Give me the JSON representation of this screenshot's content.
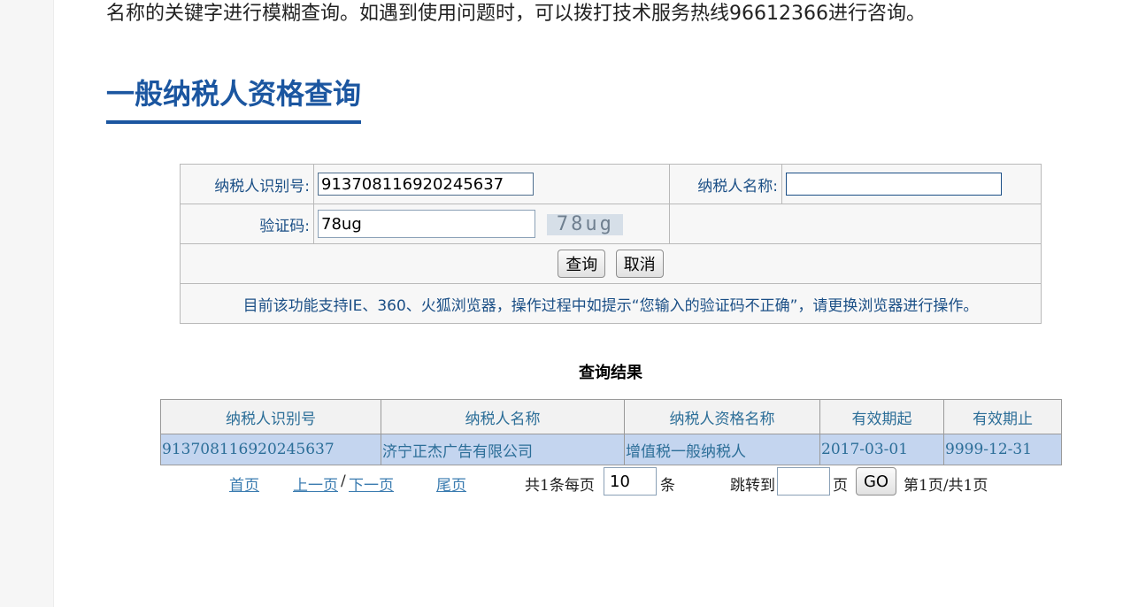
{
  "intro_text": "名称的关键字进行模糊查询。如遇到使用问题时，可以拨打技术服务热线96612366进行咨询。",
  "heading": "一般纳税人资格查询",
  "form": {
    "taxpayer_id_label": "纳税人识别号:",
    "taxpayer_id_value": "913708116920245637",
    "taxpayer_name_label": "纳税人名称:",
    "taxpayer_name_value": "",
    "captcha_label": "验证码:",
    "captcha_value": "78ug",
    "captcha_image_text": "78ug",
    "query_button": "查询",
    "cancel_button": "取消",
    "notice": "目前该功能支持IE、360、火狐浏览器，操作过程中如提示“您输入的验证码不正确”，请更换浏览器进行操作。"
  },
  "results": {
    "title": "查询结果",
    "columns": [
      "纳税人识别号",
      "纳税人名称",
      "纳税人资格名称",
      "有效期起",
      "有效期止"
    ],
    "rows": [
      [
        "913708116920245637",
        "济宁正杰广告有限公司",
        "增值税一般纳税人",
        "2017-03-01",
        "9999-12-31"
      ]
    ]
  },
  "pager": {
    "first": "首页",
    "prev": "上一页",
    "separator": "/",
    "next": "下一页",
    "last": "尾页",
    "total_prefix": "共1条每页",
    "page_size": "10",
    "page_size_unit": "条",
    "jump_label": "跳转到",
    "jump_value": "",
    "jump_unit": "页",
    "go_button": "GO",
    "status": "第1页/共1页"
  },
  "colors": {
    "heading": "#1b56a0",
    "form_text": "#1b4f86",
    "result_row_bg": "#c4d5ef",
    "result_text": "#2c6e98"
  }
}
